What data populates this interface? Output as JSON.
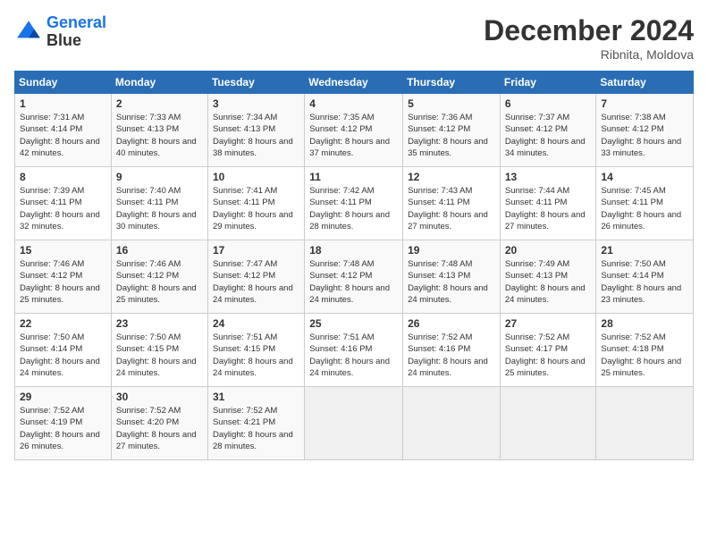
{
  "header": {
    "logo_line1": "General",
    "logo_line2": "Blue",
    "month": "December 2024",
    "location": "Ribnita, Moldova"
  },
  "weekdays": [
    "Sunday",
    "Monday",
    "Tuesday",
    "Wednesday",
    "Thursday",
    "Friday",
    "Saturday"
  ],
  "weeks": [
    [
      {
        "day": "1",
        "sunrise": "7:31 AM",
        "sunset": "4:14 PM",
        "daylight": "8 hours and 42 minutes."
      },
      {
        "day": "2",
        "sunrise": "7:33 AM",
        "sunset": "4:13 PM",
        "daylight": "8 hours and 40 minutes."
      },
      {
        "day": "3",
        "sunrise": "7:34 AM",
        "sunset": "4:13 PM",
        "daylight": "8 hours and 38 minutes."
      },
      {
        "day": "4",
        "sunrise": "7:35 AM",
        "sunset": "4:12 PM",
        "daylight": "8 hours and 37 minutes."
      },
      {
        "day": "5",
        "sunrise": "7:36 AM",
        "sunset": "4:12 PM",
        "daylight": "8 hours and 35 minutes."
      },
      {
        "day": "6",
        "sunrise": "7:37 AM",
        "sunset": "4:12 PM",
        "daylight": "8 hours and 34 minutes."
      },
      {
        "day": "7",
        "sunrise": "7:38 AM",
        "sunset": "4:12 PM",
        "daylight": "8 hours and 33 minutes."
      }
    ],
    [
      {
        "day": "8",
        "sunrise": "7:39 AM",
        "sunset": "4:11 PM",
        "daylight": "8 hours and 32 minutes."
      },
      {
        "day": "9",
        "sunrise": "7:40 AM",
        "sunset": "4:11 PM",
        "daylight": "8 hours and 30 minutes."
      },
      {
        "day": "10",
        "sunrise": "7:41 AM",
        "sunset": "4:11 PM",
        "daylight": "8 hours and 29 minutes."
      },
      {
        "day": "11",
        "sunrise": "7:42 AM",
        "sunset": "4:11 PM",
        "daylight": "8 hours and 28 minutes."
      },
      {
        "day": "12",
        "sunrise": "7:43 AM",
        "sunset": "4:11 PM",
        "daylight": "8 hours and 27 minutes."
      },
      {
        "day": "13",
        "sunrise": "7:44 AM",
        "sunset": "4:11 PM",
        "daylight": "8 hours and 27 minutes."
      },
      {
        "day": "14",
        "sunrise": "7:45 AM",
        "sunset": "4:11 PM",
        "daylight": "8 hours and 26 minutes."
      }
    ],
    [
      {
        "day": "15",
        "sunrise": "7:46 AM",
        "sunset": "4:12 PM",
        "daylight": "8 hours and 25 minutes."
      },
      {
        "day": "16",
        "sunrise": "7:46 AM",
        "sunset": "4:12 PM",
        "daylight": "8 hours and 25 minutes."
      },
      {
        "day": "17",
        "sunrise": "7:47 AM",
        "sunset": "4:12 PM",
        "daylight": "8 hours and 24 minutes."
      },
      {
        "day": "18",
        "sunrise": "7:48 AM",
        "sunset": "4:12 PM",
        "daylight": "8 hours and 24 minutes."
      },
      {
        "day": "19",
        "sunrise": "7:48 AM",
        "sunset": "4:13 PM",
        "daylight": "8 hours and 24 minutes."
      },
      {
        "day": "20",
        "sunrise": "7:49 AM",
        "sunset": "4:13 PM",
        "daylight": "8 hours and 24 minutes."
      },
      {
        "day": "21",
        "sunrise": "7:50 AM",
        "sunset": "4:14 PM",
        "daylight": "8 hours and 23 minutes."
      }
    ],
    [
      {
        "day": "22",
        "sunrise": "7:50 AM",
        "sunset": "4:14 PM",
        "daylight": "8 hours and 24 minutes."
      },
      {
        "day": "23",
        "sunrise": "7:50 AM",
        "sunset": "4:15 PM",
        "daylight": "8 hours and 24 minutes."
      },
      {
        "day": "24",
        "sunrise": "7:51 AM",
        "sunset": "4:15 PM",
        "daylight": "8 hours and 24 minutes."
      },
      {
        "day": "25",
        "sunrise": "7:51 AM",
        "sunset": "4:16 PM",
        "daylight": "8 hours and 24 minutes."
      },
      {
        "day": "26",
        "sunrise": "7:52 AM",
        "sunset": "4:16 PM",
        "daylight": "8 hours and 24 minutes."
      },
      {
        "day": "27",
        "sunrise": "7:52 AM",
        "sunset": "4:17 PM",
        "daylight": "8 hours and 25 minutes."
      },
      {
        "day": "28",
        "sunrise": "7:52 AM",
        "sunset": "4:18 PM",
        "daylight": "8 hours and 25 minutes."
      }
    ],
    [
      {
        "day": "29",
        "sunrise": "7:52 AM",
        "sunset": "4:19 PM",
        "daylight": "8 hours and 26 minutes."
      },
      {
        "day": "30",
        "sunrise": "7:52 AM",
        "sunset": "4:20 PM",
        "daylight": "8 hours and 27 minutes."
      },
      {
        "day": "31",
        "sunrise": "7:52 AM",
        "sunset": "4:21 PM",
        "daylight": "8 hours and 28 minutes."
      },
      null,
      null,
      null,
      null
    ]
  ]
}
